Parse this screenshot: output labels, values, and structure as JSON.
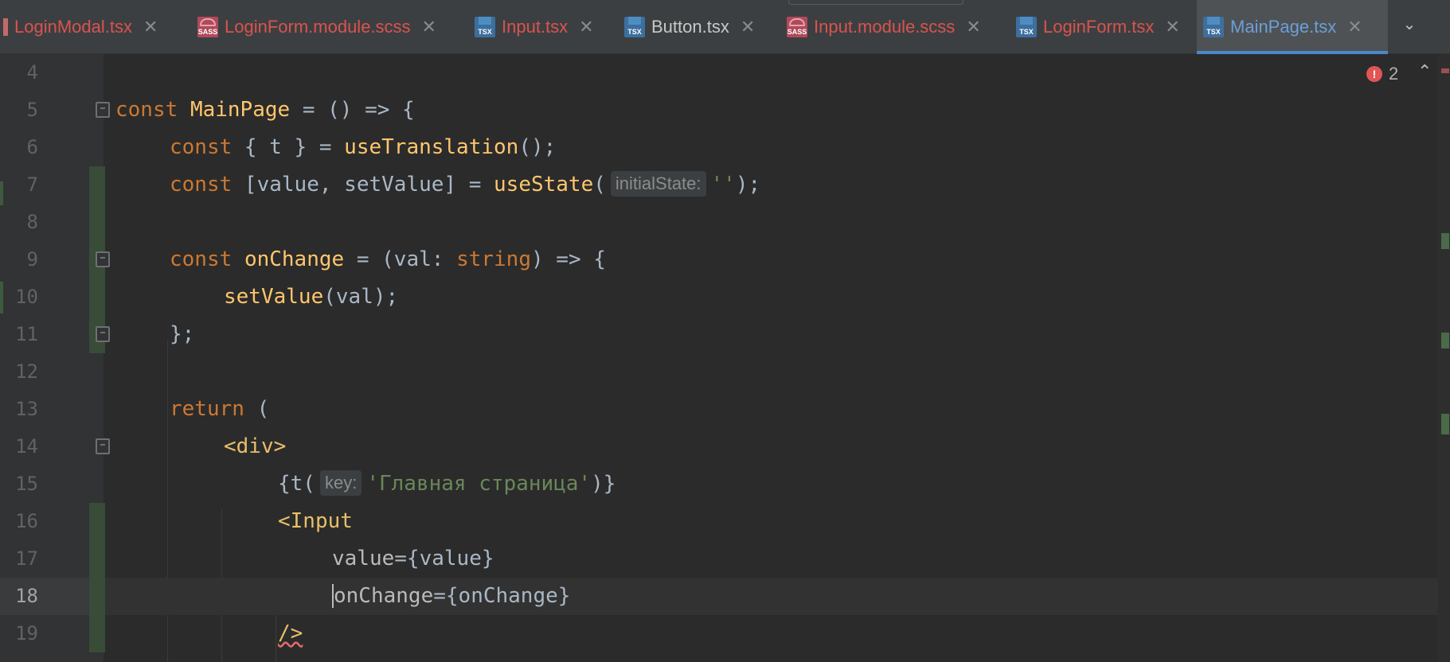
{
  "tabs": [
    {
      "label": "LoginModal.tsx",
      "icon": "plain",
      "color": "#d9534f",
      "active": false
    },
    {
      "label": "LoginForm.module.scss",
      "icon": "sass",
      "color": "#d9534f",
      "active": false
    },
    {
      "label": "Input.tsx",
      "icon": "tsx",
      "color": "#d9534f",
      "active": false
    },
    {
      "label": "Button.tsx",
      "icon": "tsx",
      "color": "#c8c8c8",
      "active": false
    },
    {
      "label": "Input.module.scss",
      "icon": "sass",
      "color": "#d9534f",
      "active": false
    },
    {
      "label": "LoginForm.tsx",
      "icon": "tsx",
      "color": "#d9534f",
      "active": false
    },
    {
      "label": "MainPage.tsx",
      "icon": "tsx",
      "color": "#6c9fd6",
      "active": true
    }
  ],
  "tab_close_glyph": "✕",
  "tab_more_glyph": "⌄",
  "tsx_badge": "TSX",
  "sass_badge": "SASS",
  "inspection": {
    "error_count": "2",
    "error_glyph": "!",
    "up_glyph": "⌃"
  },
  "lines": {
    "l4": {
      "num": "4"
    },
    "l5": {
      "num": "5",
      "kw": "const",
      "name": "MainPage",
      "rest": " = () => {"
    },
    "l6": {
      "num": "6",
      "kw": "const",
      "a": " { t } = ",
      "fn": "useTranslation",
      "b": "();"
    },
    "l7": {
      "num": "7",
      "kw": "const",
      "a": " [value, setValue] = ",
      "fn": "useState",
      "b": "(",
      "hint": "initialState:",
      "str": "''",
      "c": ");"
    },
    "l8": {
      "num": "8"
    },
    "l9": {
      "num": "9",
      "kw": "const",
      "name": "onChange",
      "a": " = (val: ",
      "type": "string",
      "b": ") => {"
    },
    "l10": {
      "num": "10",
      "fn": "setValue",
      "a": "(val);"
    },
    "l11": {
      "num": "11",
      "a": "};"
    },
    "l12": {
      "num": "12"
    },
    "l13": {
      "num": "13",
      "kw": "return",
      "a": " ("
    },
    "l14": {
      "num": "14",
      "tag": "<div>"
    },
    "l15": {
      "num": "15",
      "a": "{t(",
      "hint": "key:",
      "str": "'Главная страница'",
      "b": ")}"
    },
    "l16": {
      "num": "16",
      "tag": "<Input"
    },
    "l17": {
      "num": "17",
      "attr": "value",
      "a": "={value}"
    },
    "l18": {
      "num": "18",
      "attr": "onChange",
      "a": "={onChange}"
    },
    "l19": {
      "num": "19",
      "tag": "/>"
    }
  }
}
